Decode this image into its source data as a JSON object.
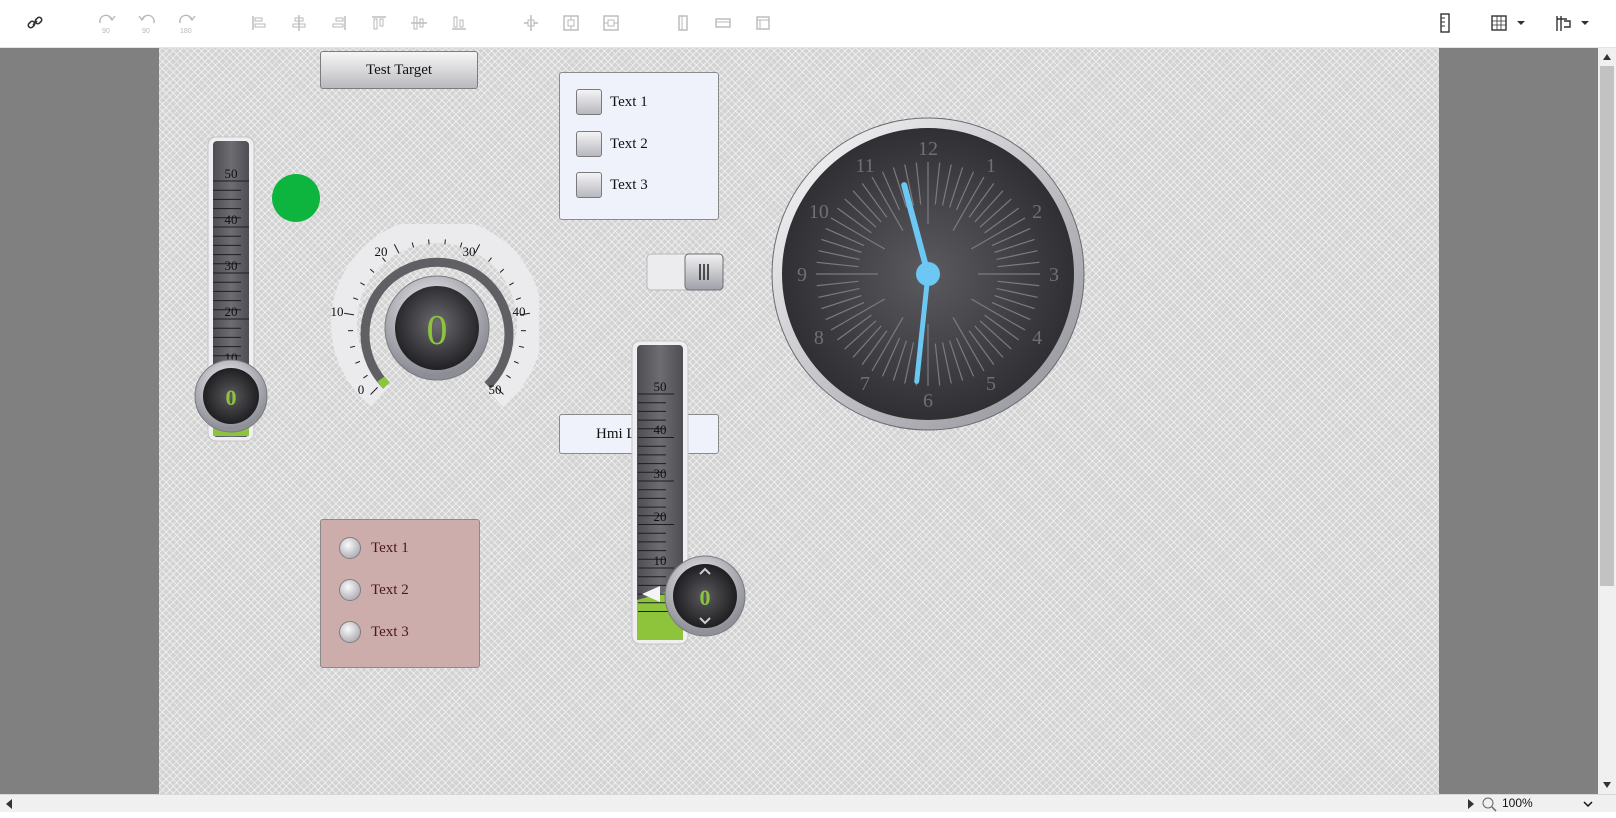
{
  "toolbar": {
    "tools": [
      {
        "name": "link-icon"
      },
      {
        "name": "rotate-cw-90-icon",
        "text": "90"
      },
      {
        "name": "rotate-ccw-90-icon",
        "text": "90"
      },
      {
        "name": "rotate-180-icon",
        "text": "180"
      },
      {
        "name": "align-left-icon"
      },
      {
        "name": "align-center-icon"
      },
      {
        "name": "align-right-icon"
      },
      {
        "name": "align-top-icon"
      },
      {
        "name": "align-middle-icon"
      },
      {
        "name": "align-bottom-icon"
      },
      {
        "name": "distribute-icon"
      },
      {
        "name": "center-horizontal-icon"
      },
      {
        "name": "center-vertical-icon"
      },
      {
        "name": "same-width-icon"
      },
      {
        "name": "same-height-icon"
      },
      {
        "name": "same-size-icon"
      },
      {
        "name": "ruler-icon"
      },
      {
        "name": "grid-icon"
      },
      {
        "name": "snap-icon"
      }
    ]
  },
  "canvas": {
    "test_button": "Test Target",
    "checkbox_group": {
      "items": [
        "Text 1",
        "Text 2",
        "Text 3"
      ]
    },
    "radio_group": {
      "items": [
        "Text 1",
        "Text 2",
        "Text 3"
      ]
    },
    "hmi_label": "Hmi L",
    "led_color": "#0db43e",
    "slider_value": 1.0,
    "thermometer_left": {
      "value": "0",
      "ticks": [
        "50",
        "40",
        "30",
        "20",
        "10"
      ]
    },
    "thermometer_center": {
      "value": "0",
      "ticks": [
        "50",
        "40",
        "30",
        "20",
        "10"
      ]
    },
    "gauge": {
      "value": "0",
      "ticks": [
        "0",
        "10",
        "20",
        "30",
        "40",
        "50"
      ]
    },
    "clock": {
      "numbers": [
        "12",
        "1",
        "2",
        "3",
        "4",
        "5",
        "6",
        "7",
        "8",
        "9",
        "10",
        "11"
      ],
      "hour": 11.5,
      "minute": 31
    }
  },
  "statusbar": {
    "zoom": "100%"
  },
  "colors": {
    "accent_green": "#8dc43c",
    "clock_hand": "#6cc8f2",
    "workspace": "#808080"
  }
}
